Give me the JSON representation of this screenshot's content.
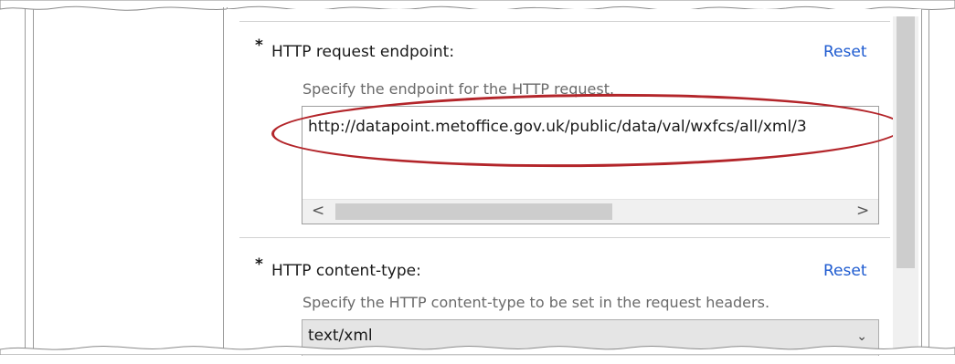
{
  "fields": [
    {
      "required_marker": "*",
      "label": "HTTP request endpoint:",
      "reset_label": "Reset",
      "description": "Specify the endpoint for the HTTP request.",
      "value": "http://datapoint.metoffice.gov.uk/public/data/val/wxfcs/all/xml/3"
    },
    {
      "required_marker": "*",
      "label": "HTTP content-type:",
      "reset_label": "Reset",
      "description": "Specify the HTTP content-type to be set in the request headers.",
      "value": "text/xml"
    }
  ],
  "scrollbar": {
    "left_arrow": "<",
    "right_arrow": ">"
  },
  "icons": {
    "dropdown": "chevron-down-icon"
  },
  "colors": {
    "link": "#1e5bd0",
    "highlight_ellipse": "#b3252a",
    "description_text": "#6a6a6a"
  }
}
